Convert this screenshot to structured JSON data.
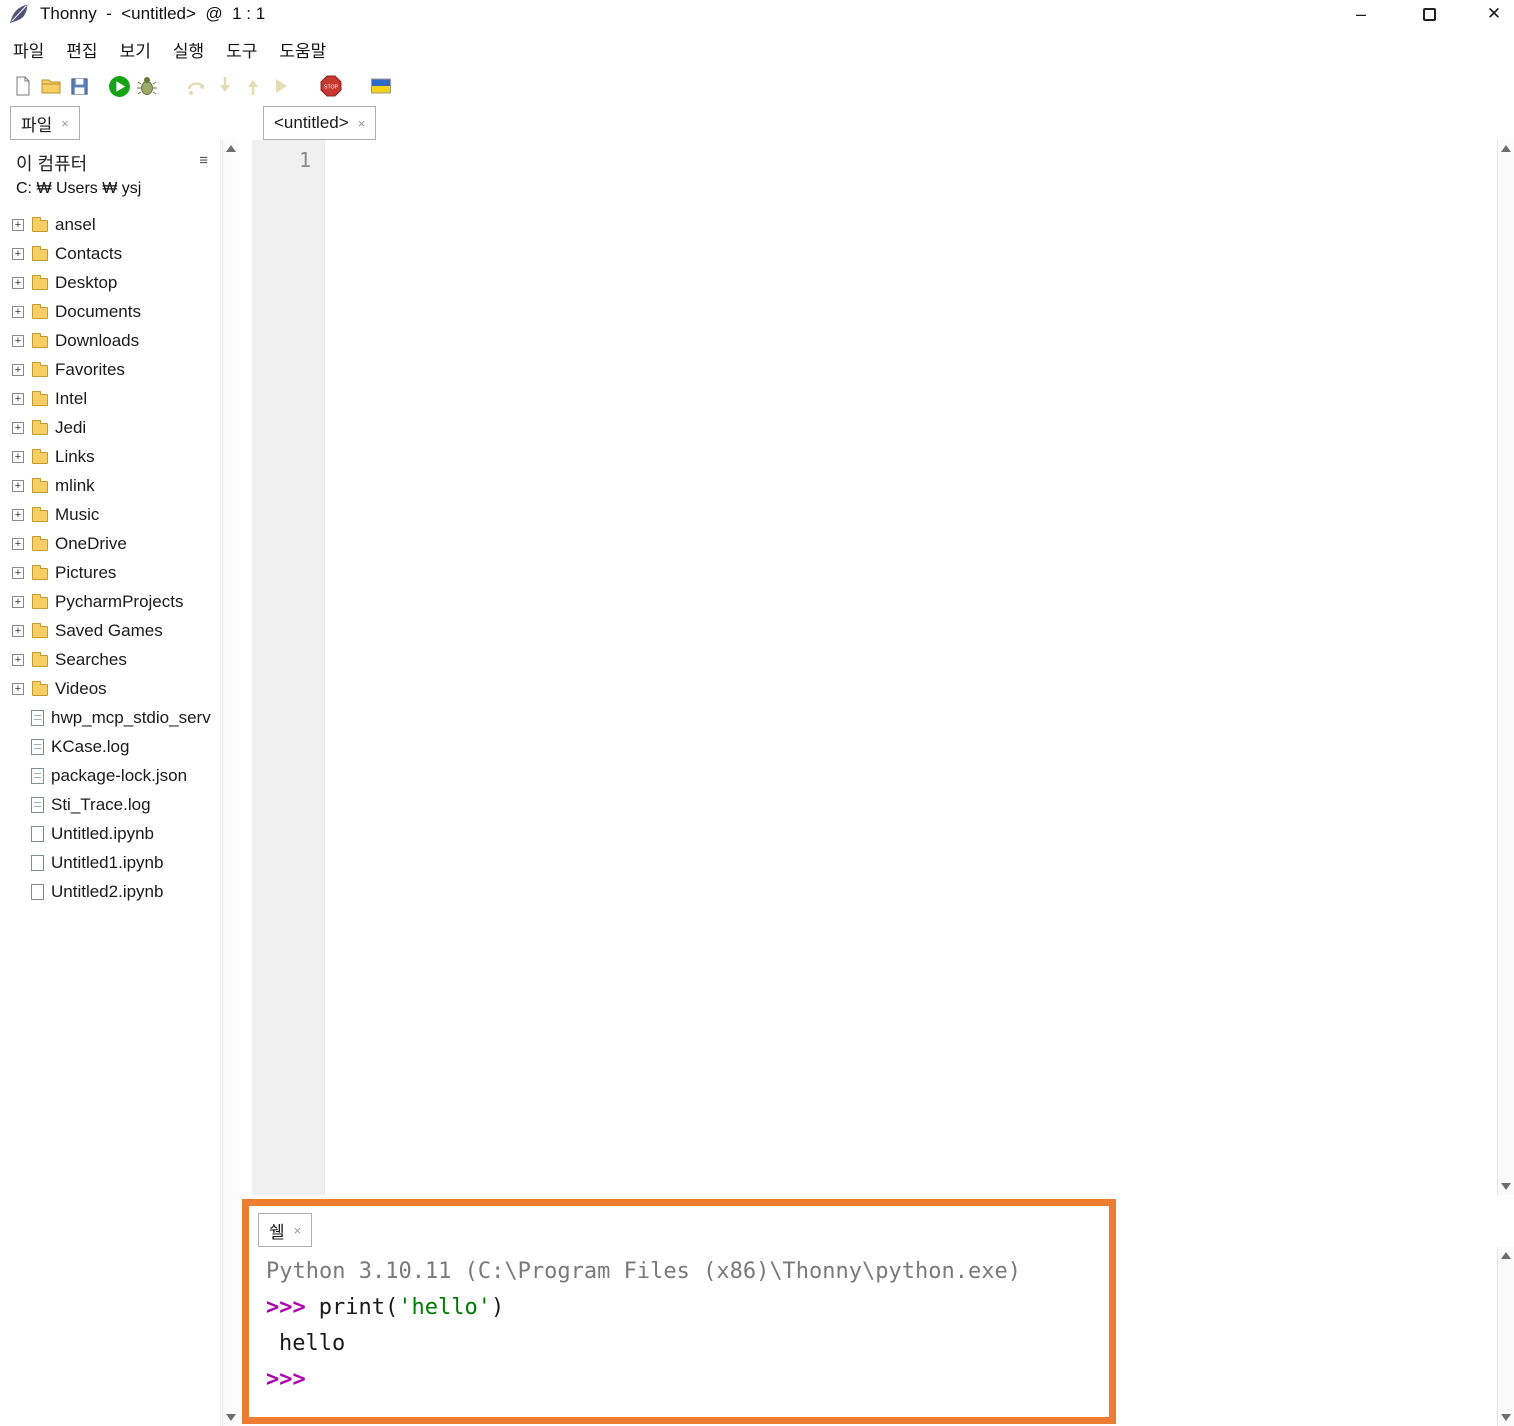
{
  "window": {
    "title": "Thonny  -  <untitled>  @  1 : 1"
  },
  "glyphs": {
    "close": "×",
    "expand": "+",
    "menu": "≡",
    "minimize": "–",
    "window_close": "✕"
  },
  "menu": {
    "items": [
      "파일",
      "편집",
      "보기",
      "실행",
      "도구",
      "도움말"
    ]
  },
  "toolbar": {
    "icons": [
      "new-file",
      "open-file",
      "save-file",
      "run-script",
      "debug-script",
      "step-over",
      "step-into",
      "step-out",
      "resume",
      "stop",
      "ukraine-flag"
    ],
    "stop_label": "STOP"
  },
  "files_panel": {
    "tab_label": "파일",
    "header": "이 컴퓨터",
    "path": "C: ₩ Users ₩ ysj",
    "folders": [
      "ansel",
      "Contacts",
      "Desktop",
      "Documents",
      "Downloads",
      "Favorites",
      "Intel",
      "Jedi",
      "Links",
      "mlink",
      "Music",
      "OneDrive",
      "Pictures",
      "PycharmProjects",
      "Saved Games",
      "Searches",
      "Videos"
    ],
    "files": [
      {
        "name": "hwp_mcp_stdio_serv"
      },
      {
        "name": "KCase.log"
      },
      {
        "name": "package-lock.json"
      },
      {
        "name": "Sti_Trace.log"
      },
      {
        "name": "Untitled.ipynb"
      },
      {
        "name": "Untitled1.ipynb"
      },
      {
        "name": "Untitled2.ipynb"
      }
    ]
  },
  "editor": {
    "tab_label": "<untitled>",
    "line_numbers": [
      "1"
    ]
  },
  "shell": {
    "tab_label": "쉘",
    "banner": "Python 3.10.11 (C:\\Program Files (x86)\\Thonny\\python.exe)",
    "prompt": ">>>",
    "code_func": "print(",
    "code_string": "'hello'",
    "code_close": ")",
    "output": "hello"
  },
  "colors": {
    "prompt": "#B000B0",
    "string_green": "#007A00",
    "banner_gray": "#7A7A7A",
    "annotation_orange": "#ED7D31",
    "run_green": "#17A317",
    "flag_top": "#2F6BC6",
    "flag_bottom": "#F7D117",
    "folder_yellow": "#F7CE63"
  }
}
